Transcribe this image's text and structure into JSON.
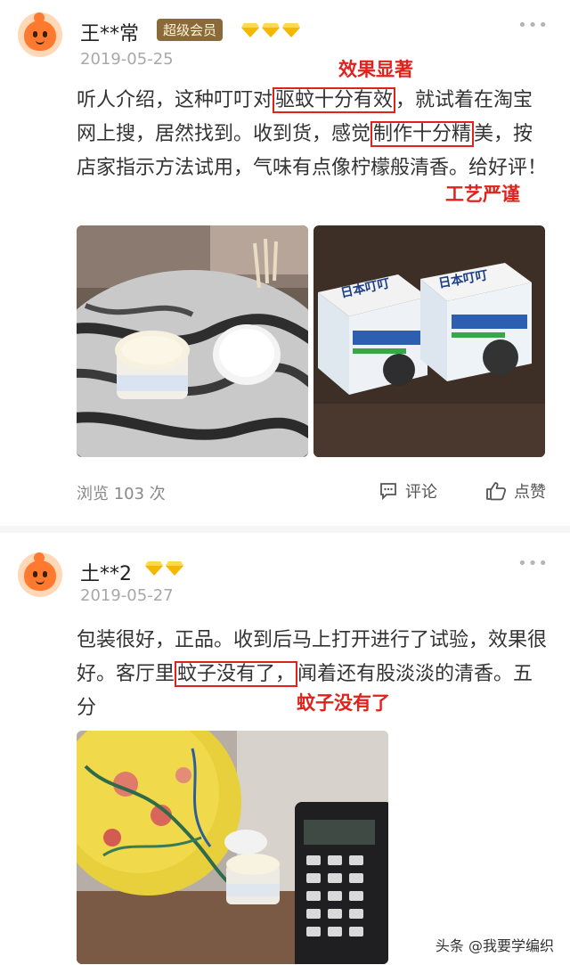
{
  "reviews": [
    {
      "username": "王**常",
      "badge": "超级会员",
      "date": "2019-05-25",
      "text_part1": "听人介绍，这种叮叮对",
      "highlight1": "驱蚊十分有效",
      "text_part2": "，就试着在淘宝网上搜，居然找到。收到货，感觉",
      "highlight2": "制作十分精",
      "text_part3": "美，按店家指示方法试用，气味有点像柠檬般清香。给好评！",
      "annotation1": "效果显著",
      "annotation2": "工艺严谨",
      "views": "浏览 103 次",
      "comment_label": "评论",
      "like_label": "点赞",
      "more": "•••"
    },
    {
      "username": "土**2",
      "date": "2019-05-27",
      "text_part1": "包装很好，正品。收到后马上打开进行了试验，效果很好。客厅里",
      "highlight1": "蚊子没有了，",
      "text_part2": "闻着还有股淡淡的清香。五分",
      "annotation1": "蚊子没有了",
      "more": "•••"
    }
  ],
  "photo_labels": {
    "box_brand": "日本叮叮"
  },
  "watermark": "头条 @我要学编织",
  "colors": {
    "annotation": "#e0221c",
    "badge_bg": "#8a6a3a",
    "diamond": "#f5b800"
  }
}
